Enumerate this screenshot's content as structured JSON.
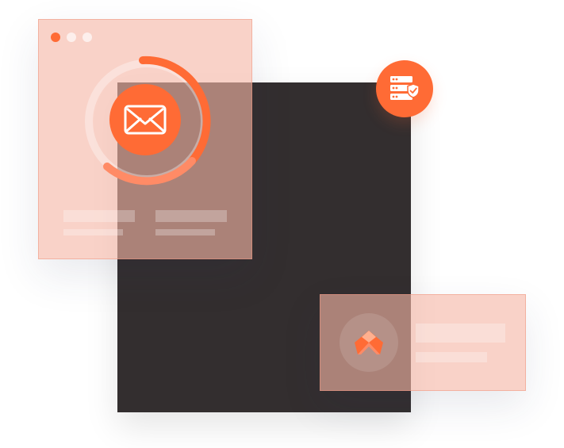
{
  "colors": {
    "accent": "#ff6b35",
    "dark_panel": "#332e2f",
    "pink_overlay": "#f6b7a6",
    "white": "#ffffff"
  },
  "icons": {
    "window_dots": [
      "close-dot",
      "minimize-dot",
      "maximize-dot"
    ],
    "mail": "envelope-icon",
    "server": "server-shield-icon",
    "logo": "mountain-logo-icon"
  },
  "progress_ring": {
    "fraction": 0.55
  }
}
